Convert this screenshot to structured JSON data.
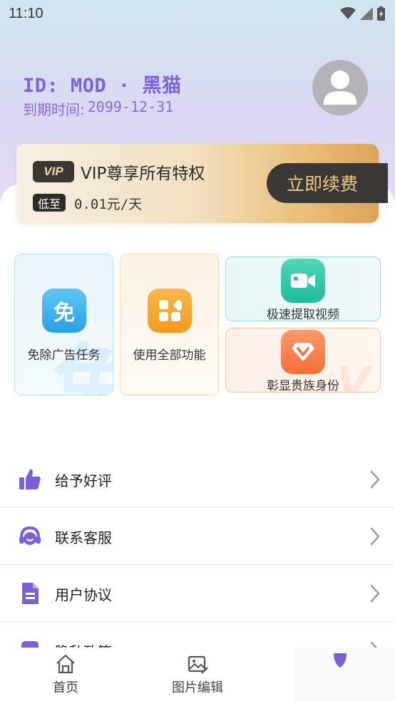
{
  "status_bar": {
    "time": "11:10"
  },
  "profile": {
    "user_id": "ID: MOD · 黑猫",
    "expire_label": "到期时间:",
    "expire_date": "2099-12-31"
  },
  "vip_card": {
    "badge": "VIP",
    "title": "VIP尊享所有特权",
    "low_label": "低至",
    "price": "0.01元/天",
    "renew_button": "立即续费"
  },
  "features": [
    {
      "label": "免除广告任务",
      "icon": "mian-icon"
    },
    {
      "label": "使用全部功能",
      "icon": "apps-icon"
    },
    {
      "label": "极速提取视频",
      "icon": "video-camera-icon"
    },
    {
      "label": "彰显贵族身份",
      "icon": "diamond-v-icon"
    }
  ],
  "menu": [
    {
      "label": "给予好评",
      "icon": "thumbs-up-icon"
    },
    {
      "label": "联系客服",
      "icon": "headset-icon"
    },
    {
      "label": "用户协议",
      "icon": "document-icon"
    },
    {
      "label": "隐私政策",
      "icon": "privacy-icon"
    }
  ],
  "bottom_nav": [
    {
      "label": "首页",
      "icon": "home-icon"
    },
    {
      "label": "图片编辑",
      "icon": "image-edit-icon"
    },
    {
      "label": "",
      "icon": "profile-icon"
    }
  ],
  "colors": {
    "accent": "#7d63d9",
    "vip_gold": "#dca45a",
    "dark": "#3a3734"
  }
}
